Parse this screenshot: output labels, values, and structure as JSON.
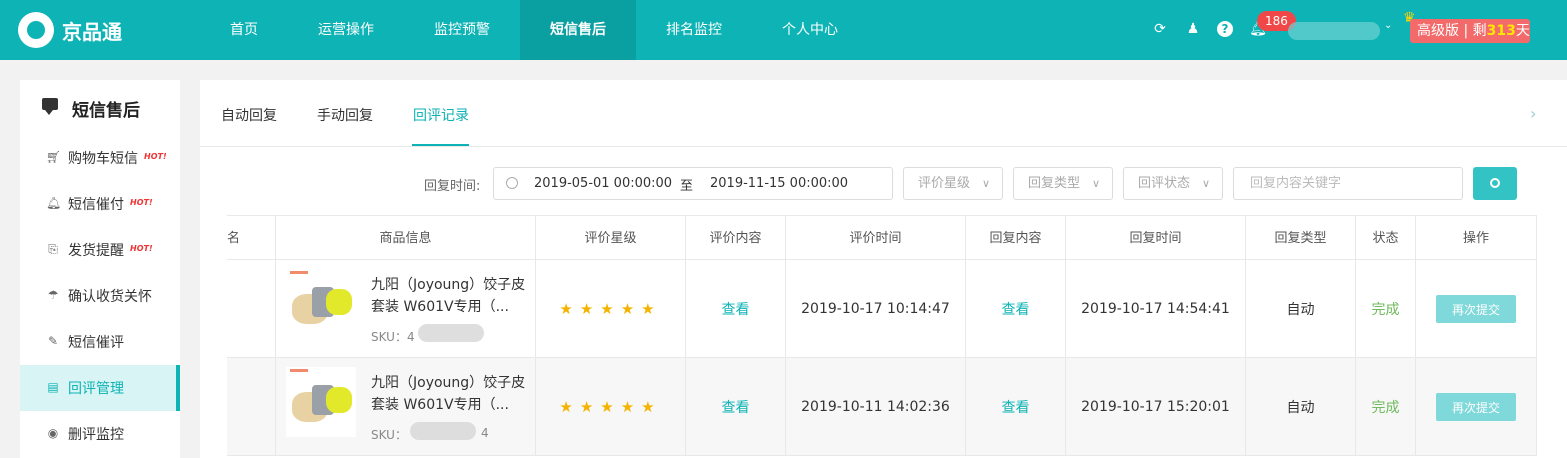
{
  "header": {
    "app_name": "京品通",
    "nav": [
      "首页",
      "运营操作",
      "监控预警",
      "短信售后",
      "排名监控",
      "个人中心"
    ],
    "active_nav_index": 3,
    "notification_count": "186",
    "user_caret": "⌄",
    "vip": {
      "label": "高级版",
      "divider": "|",
      "remain_prefix": "剩",
      "days": "313",
      "suffix": "天"
    },
    "icons": [
      "refresh-icon",
      "qq-icon",
      "help-icon",
      "bell-icon",
      "crown-icon"
    ],
    "brand_color": "#0db3b5"
  },
  "sidebar": {
    "title": "短信售后",
    "items": [
      {
        "label": "购物车短信",
        "hot": "HOT!",
        "icon": "cart-icon"
      },
      {
        "label": "短信催付",
        "hot": "HOT!",
        "icon": "bell-icon"
      },
      {
        "label": "发货提醒",
        "hot": "HOT!",
        "icon": "package-icon"
      },
      {
        "label": "确认收货关怀",
        "hot": "",
        "icon": "umbrella-icon"
      },
      {
        "label": "短信催评",
        "hot": "",
        "icon": "edit-icon"
      },
      {
        "label": "回评管理",
        "hot": "",
        "icon": "document-icon"
      },
      {
        "label": "删评监控",
        "hot": "",
        "icon": "eye-icon"
      }
    ],
    "active_index": 5
  },
  "tabs": {
    "items": [
      "自动回复",
      "手动回复",
      "回评记录"
    ],
    "active_index": 2,
    "arrow": "›"
  },
  "filters": {
    "time_label": "回复时间:",
    "date_start": "2019-05-01 00:00:00",
    "date_sep": "至",
    "date_end": "2019-11-15 00:00:00",
    "rating_placeholder": "评价星级",
    "reply_type_placeholder": "回复类型",
    "review_status_placeholder": "回评状态",
    "keyword_placeholder": "回复内容关键字"
  },
  "table": {
    "headers": [
      "名",
      "商品信息",
      "评价星级",
      "评价内容",
      "评价时间",
      "回复内容",
      "回复时间",
      "回复类型",
      "状态",
      "操作"
    ],
    "rows": [
      {
        "product_name": "九阳（Joyoung）饺子皮套装 W601V专用（...",
        "sku_label": "SKU：",
        "sku_prefix": "4",
        "sku_suffix": "",
        "stars": "★★★★★",
        "review_content": "查看",
        "review_time": "2019-10-17 10:14:47",
        "reply_content": "查看",
        "reply_time": "2019-10-17 14:54:41",
        "reply_type": "自动",
        "status": "完成",
        "action": "再次提交"
      },
      {
        "product_name": "九阳（Joyoung）饺子皮套装 W601V专用（...",
        "sku_label": "SKU：",
        "sku_prefix": "",
        "sku_suffix": "4",
        "stars": "★★★★★",
        "review_content": "查看",
        "review_time": "2019-10-11 14:02:36",
        "reply_content": "查看",
        "reply_time": "2019-10-17 15:20:01",
        "reply_type": "自动",
        "status": "完成",
        "action": "再次提交"
      }
    ]
  }
}
